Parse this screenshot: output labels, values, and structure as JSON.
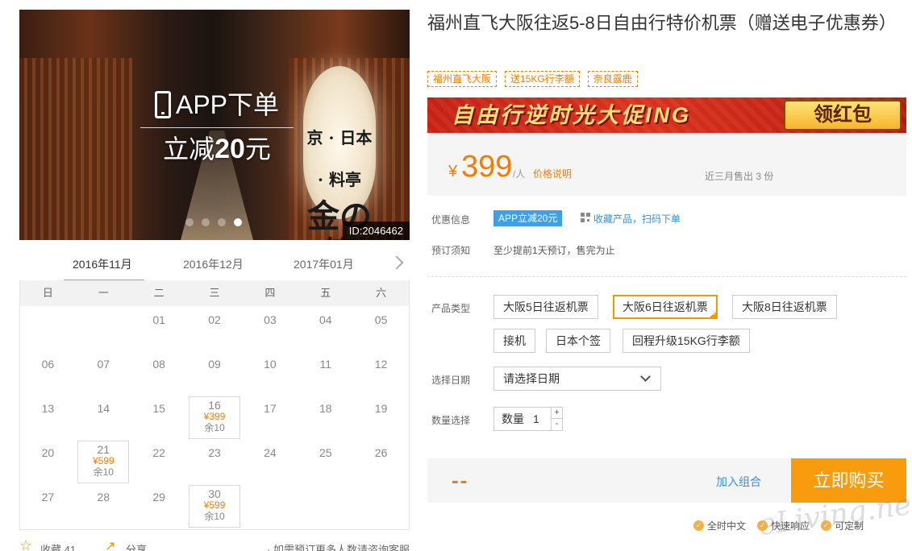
{
  "hero": {
    "overlay_line1": "APP下单",
    "overlay_line2_prefix": "立减",
    "overlay_line2_amount": "20",
    "overlay_line2_suffix": "元",
    "lantern_text": "金の箸",
    "lantern_small": "京 · 日本 · 料亭",
    "id_badge": "ID:2046462",
    "slides": 4,
    "active_slide": 4
  },
  "calendar": {
    "months": [
      "2016年11月",
      "2016年12月",
      "2017年01月"
    ],
    "active_month": 0,
    "weekdays": [
      "日",
      "一",
      "二",
      "三",
      "四",
      "五",
      "六"
    ],
    "weeks": [
      [
        {
          "d": ""
        },
        {
          "d": ""
        },
        {
          "d": "01"
        },
        {
          "d": "02"
        },
        {
          "d": "03"
        },
        {
          "d": "04"
        },
        {
          "d": "05"
        }
      ],
      [
        {
          "d": "06"
        },
        {
          "d": "07"
        },
        {
          "d": "08"
        },
        {
          "d": "09"
        },
        {
          "d": "10"
        },
        {
          "d": "11"
        },
        {
          "d": "12"
        }
      ],
      [
        {
          "d": "13"
        },
        {
          "d": "14"
        },
        {
          "d": "15"
        },
        {
          "d": "16",
          "price": "¥399",
          "stock": "余10"
        },
        {
          "d": "17"
        },
        {
          "d": "18"
        },
        {
          "d": "19"
        }
      ],
      [
        {
          "d": "20"
        },
        {
          "d": "21",
          "price": "¥599",
          "stock": "余10"
        },
        {
          "d": "22"
        },
        {
          "d": "23"
        },
        {
          "d": "24"
        },
        {
          "d": "25"
        },
        {
          "d": "26"
        }
      ],
      [
        {
          "d": "27"
        },
        {
          "d": "28"
        },
        {
          "d": "29"
        },
        {
          "d": "30",
          "price": "¥599",
          "stock": "余10"
        },
        {
          "d": ""
        },
        {
          "d": ""
        },
        {
          "d": ""
        }
      ]
    ]
  },
  "left_footer": {
    "favorite_label": "收藏 41",
    "share_label": "分享",
    "contact_note": "· 如需预订更多人数请咨询客服"
  },
  "product": {
    "title": "福州直飞大阪往返5-8日自由行特价机票（赠送电子优惠券）",
    "tags": [
      "福州直飞大阪",
      "送15KG行李额",
      "奈良露鹿"
    ],
    "promo_text": "自由行逆时光大促ING",
    "promo_button": "领红包",
    "currency": "¥",
    "price": "399",
    "unit": "/人",
    "price_note": "价格说明",
    "sold": "近三月售出 3 份"
  },
  "info": {
    "discount_label": "优惠信息",
    "app_badge": "APP立减20元",
    "qr_link": "收藏产品，扫码下单",
    "notice_label": "预订须知",
    "notice_text": "至少提前1天预订，售完为止"
  },
  "options": {
    "type_label": "产品类型",
    "items": [
      "大阪5日往返机票",
      "大阪6日往返机票",
      "大阪8日往返机票",
      "接机",
      "日本个签",
      "回程升级15KG行李额"
    ],
    "selected": 1,
    "date_label": "选择日期",
    "date_placeholder": "请选择日期",
    "qty_label": "数量选择",
    "qty_inner_label": "数量",
    "qty_value": "1",
    "qty_plus": "+",
    "qty_minus": "-"
  },
  "buy": {
    "total": "--",
    "combo_link": "加入组合",
    "buy_button": "立即购买"
  },
  "guarantees": [
    "全时中文",
    "快速响应",
    "可定制"
  ],
  "watermark": "eLiving.net",
  "colors": {
    "accent": "#f39800",
    "price": "#f37d00",
    "link": "#3a8fd6",
    "badge": "#3fa0e6",
    "buy_button": "#f89c0e",
    "banner": "#c62214"
  }
}
